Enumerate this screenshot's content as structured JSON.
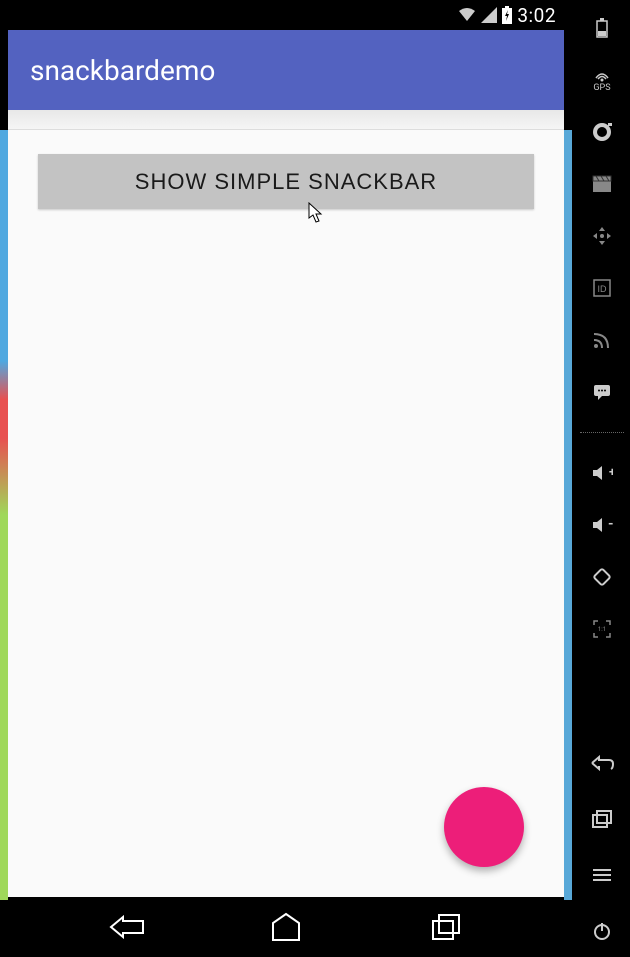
{
  "status_bar": {
    "time": "3:02"
  },
  "app_bar": {
    "title": "snackbardemo"
  },
  "main": {
    "button_label": "SHOW SIMPLE SNACKBAR"
  },
  "colors": {
    "primary": "#5362c0",
    "fab": "#ed1e79",
    "button_bg": "#c3c3c3"
  },
  "sidebar": {
    "gps_label": "GPS"
  }
}
